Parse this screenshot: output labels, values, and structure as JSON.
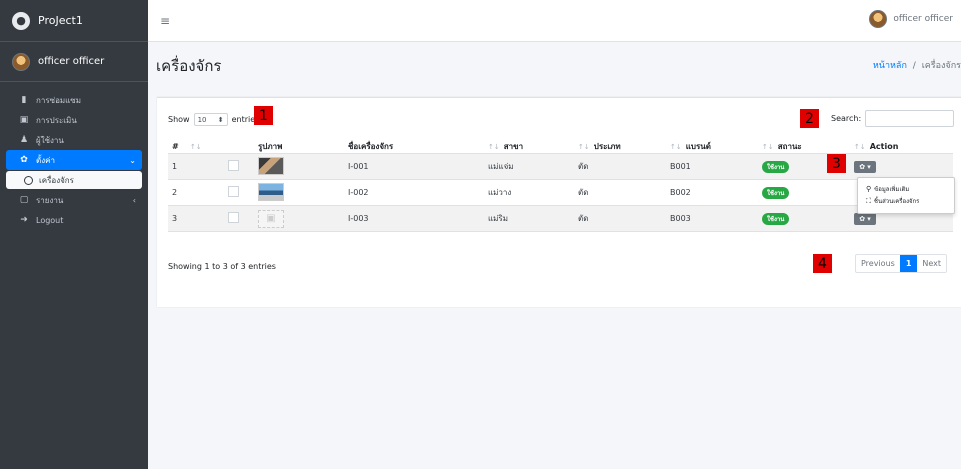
{
  "app": {
    "title": "ProJect1"
  },
  "sidebar": {
    "user_name": "officer officer",
    "items": [
      {
        "label": "การซ่อมแซม",
        "icon": "file-icon"
      },
      {
        "label": "การประเมิน",
        "icon": "edit-icon"
      },
      {
        "label": "ผู้ใช้งาน",
        "icon": "users-icon"
      },
      {
        "label": "ตั้งค่า",
        "icon": "gear-icon"
      },
      {
        "label": "เครื่องจักร",
        "icon": "circle-icon"
      },
      {
        "label": "รายงาน",
        "icon": "report-icon"
      },
      {
        "label": "Logout",
        "icon": "logout-icon"
      }
    ]
  },
  "header": {
    "user_name": "officer officer"
  },
  "page": {
    "title": "เครื่องจักร",
    "breadcrumb_home": "หน้าหลัก",
    "breadcrumb_sep": "/",
    "breadcrumb_current": "เครื่องจักร"
  },
  "table_controls": {
    "show_label": "Show",
    "entries_value": "10",
    "entries_label": "entries",
    "search_label": "Search:",
    "showing_text": "Showing 1 to 3 of 3 entries",
    "prev_label": "Previous",
    "current_page": "1",
    "next_label": "Next"
  },
  "table": {
    "headers": [
      "#",
      "รูปภาพ",
      "ชื่อเครื่องจักร",
      "สาขา",
      "ประเภท",
      "แบรนด์",
      "สถานะ",
      "Action"
    ],
    "rows": [
      {
        "num": "1",
        "code": "I-001",
        "branch": "แม่แจ่ม",
        "type": "ตัด",
        "brand": "B001",
        "status": "ใช้งาน"
      },
      {
        "num": "2",
        "code": "I-002",
        "branch": "แม่วาง",
        "type": "ตัด",
        "brand": "B002",
        "status": "ใช้งาน"
      },
      {
        "num": "3",
        "code": "I-003",
        "branch": "แม่ริม",
        "type": "ตัด",
        "brand": "B003",
        "status": "ใช้งาน"
      }
    ]
  },
  "dropdown": {
    "item1": "ข้อมูลเพิ่มเติม",
    "item2": "ชิ้นส่วนเครื่องจักร"
  },
  "annotations": [
    "1",
    "2",
    "3",
    "4"
  ],
  "colors": {
    "primary": "#007bff",
    "sidebar": "#343a40",
    "success": "#28a745",
    "marker": "#e00000"
  }
}
